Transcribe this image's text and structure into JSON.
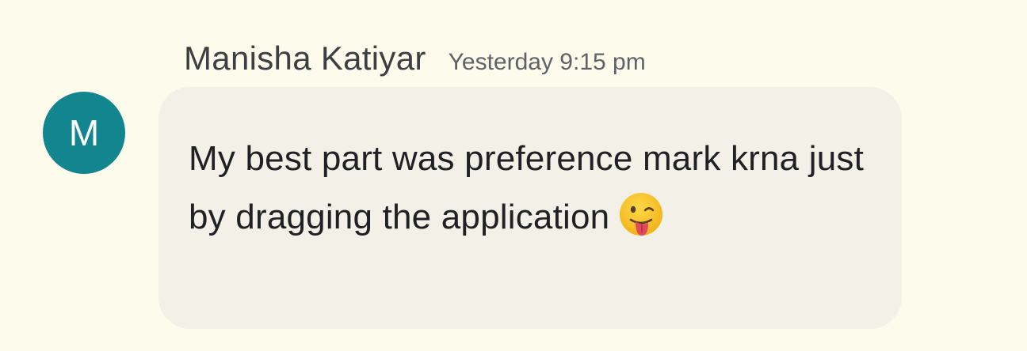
{
  "message": {
    "sender_name": "Manisha Katiyar",
    "timestamp": "Yesterday 9:15 pm",
    "avatar_letter": "M",
    "text": "My best part was preference mark krna just by dragging the application",
    "emoji": "winking-face-with-tongue-icon"
  },
  "colors": {
    "page_background": "#fdfbeb",
    "bubble_background": "#f3f0e8",
    "avatar_background": "#12858f",
    "text": "#202124"
  }
}
